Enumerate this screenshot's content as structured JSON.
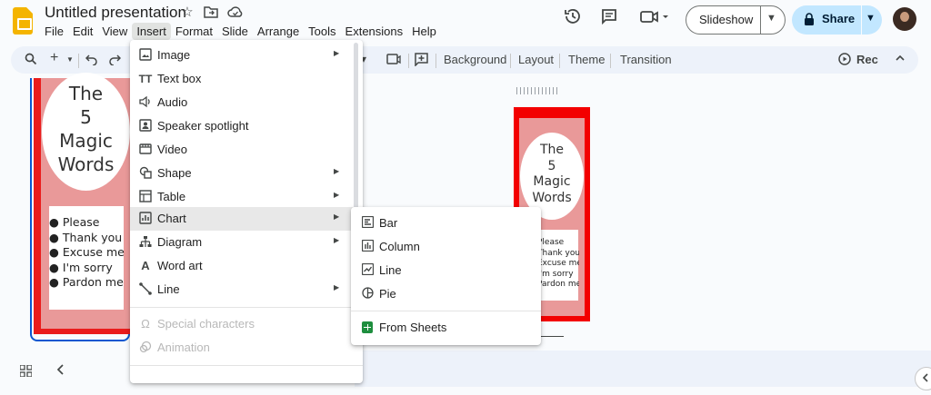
{
  "header": {
    "title": "Untitled presentation",
    "menus": [
      "File",
      "Edit",
      "View",
      "Insert",
      "Format",
      "Slide",
      "Arrange",
      "Tools",
      "Extensions",
      "Help"
    ],
    "slideshow_label": "Slideshow",
    "share_label": "Share",
    "colors": {
      "share_bg": "#c2e7ff",
      "active_menu_bg": "#e1e3e1"
    }
  },
  "toolbar": {
    "background": "Background",
    "layout": "Layout",
    "theme": "Theme",
    "transition": "Transition",
    "rec": "Rec"
  },
  "slide": {
    "title_lines": [
      "The",
      "5",
      "Magic",
      "Words"
    ],
    "items": [
      "Please",
      "Thank you",
      "Excuse me",
      "I'm sorry",
      "Pardon me"
    ],
    "colors": {
      "frame": "#f30000",
      "panel": "#e99999"
    }
  },
  "insert_menu": {
    "items": [
      {
        "label": "Image",
        "icon": "image-icon",
        "submenu": true
      },
      {
        "label": "Text box",
        "icon": "text-box-icon",
        "submenu": false
      },
      {
        "label": "Audio",
        "icon": "audio-icon",
        "submenu": false
      },
      {
        "label": "Speaker spotlight",
        "icon": "speaker-spotlight-icon",
        "submenu": false
      },
      {
        "label": "Video",
        "icon": "video-icon",
        "submenu": false
      },
      {
        "label": "Shape",
        "icon": "shape-icon",
        "submenu": true
      },
      {
        "label": "Table",
        "icon": "table-icon",
        "submenu": true
      },
      {
        "label": "Chart",
        "icon": "chart-icon",
        "submenu": true,
        "highlighted": true
      },
      {
        "label": "Diagram",
        "icon": "diagram-icon",
        "submenu": true
      },
      {
        "label": "Word art",
        "icon": "word-art-icon",
        "submenu": false
      },
      {
        "label": "Line",
        "icon": "line-icon",
        "submenu": true
      }
    ],
    "disabled_items": [
      {
        "label": "Special characters",
        "icon": "omega-icon"
      },
      {
        "label": "Animation",
        "icon": "animation-icon"
      }
    ]
  },
  "chart_submenu": {
    "items": [
      {
        "label": "Bar",
        "icon": "bar-chart-icon"
      },
      {
        "label": "Column",
        "icon": "column-chart-icon"
      },
      {
        "label": "Line",
        "icon": "line-chart-icon"
      },
      {
        "label": "Pie",
        "icon": "pie-chart-icon"
      }
    ],
    "from_sheets": "From Sheets"
  }
}
